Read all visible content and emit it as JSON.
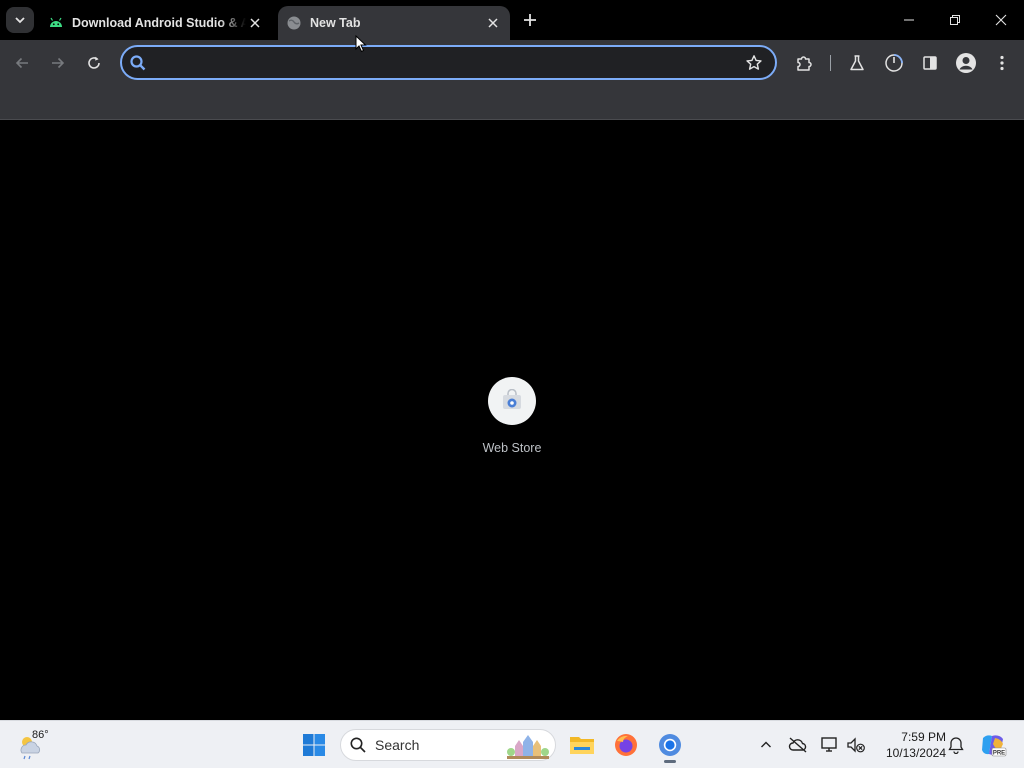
{
  "browser": {
    "tabs": [
      {
        "title": "Download Android Studio & App Tools",
        "favicon": "android-icon",
        "active": false
      },
      {
        "title": "New Tab",
        "favicon": "globe-icon",
        "active": true
      }
    ],
    "omnibox": {
      "value": "",
      "placeholder": ""
    },
    "toolbar_icons": [
      "back-icon",
      "forward-icon",
      "reload-icon",
      "star-icon",
      "extensions-icon",
      "labs-icon",
      "performance-icon",
      "side-panel-icon",
      "profile-icon",
      "menu-icon"
    ]
  },
  "new_tab": {
    "shortcuts": [
      {
        "label": "Web Store",
        "icon": "web-store-icon"
      }
    ]
  },
  "taskbar": {
    "weather": {
      "temp": "86°"
    },
    "search_label": "Search",
    "clock": {
      "time": "7:59 PM",
      "date": "10/13/2024"
    },
    "copilot_badge": "PRE"
  },
  "colors": {
    "accent_focus": "#7cacf8",
    "toolbar_bg": "#35363a",
    "page_bg": "#000000",
    "taskbar_bg": "#eef0f4"
  }
}
